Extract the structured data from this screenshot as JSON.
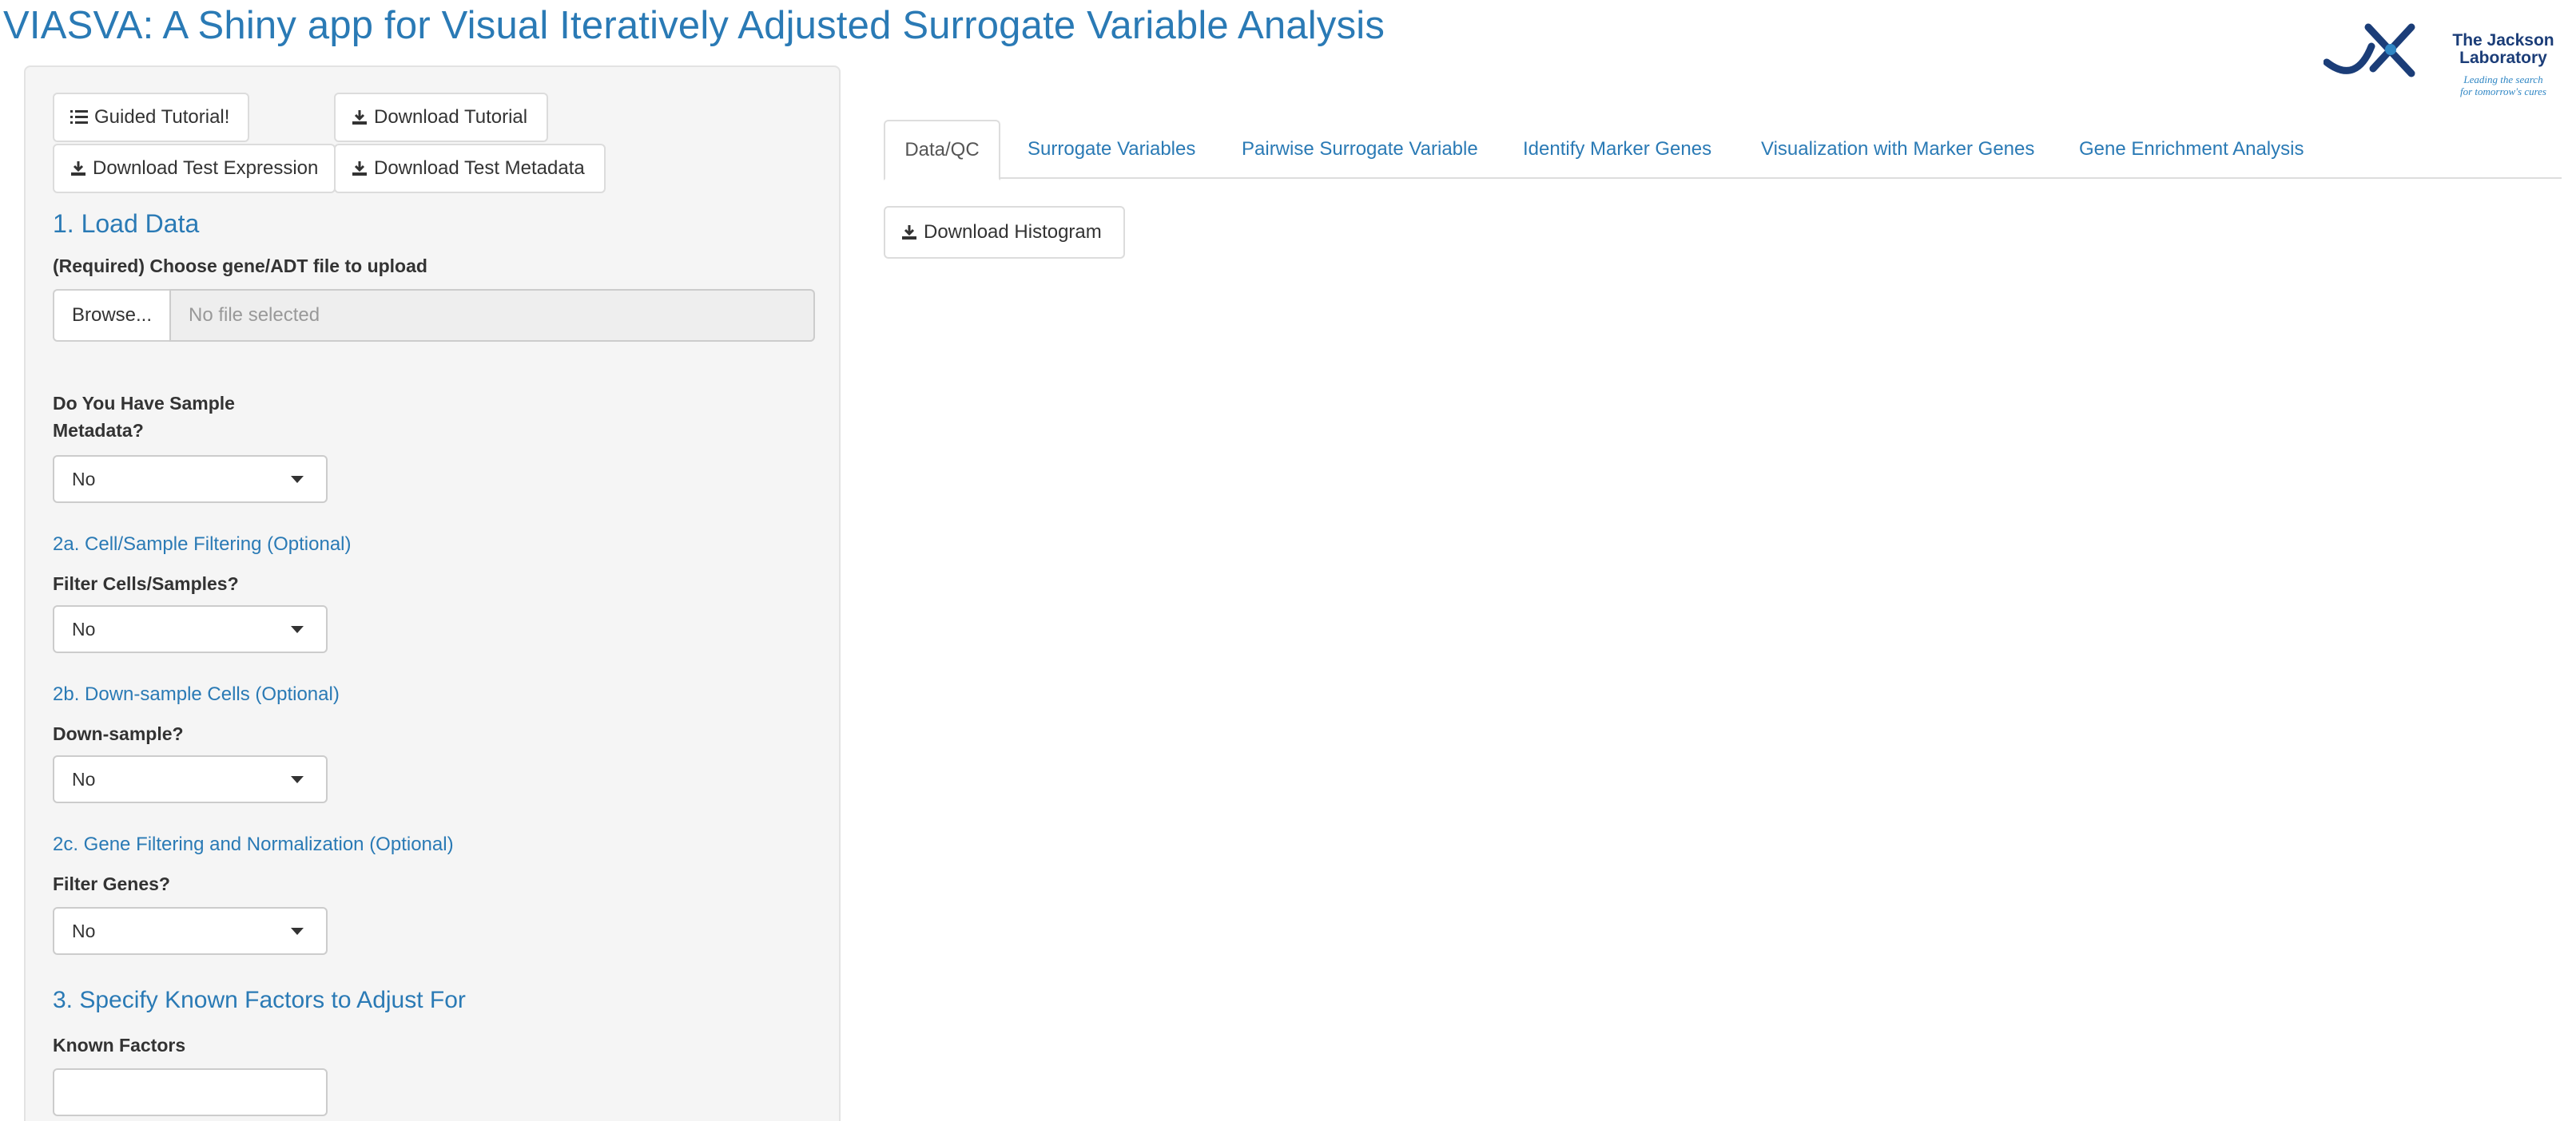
{
  "app": {
    "title": "VIASVA: A Shiny app for Visual Iteratively Adjusted Surrogate Variable Analysis"
  },
  "logo": {
    "name_line1": "The Jackson",
    "name_line2": "Laboratory",
    "tagline_line1": "Leading the search",
    "tagline_line2": "for tomorrow's cures",
    "mark_color": "#1b3d78",
    "accent_color": "#2f86c4"
  },
  "sidebar": {
    "buttons": {
      "guided_tutorial": "Guided Tutorial!",
      "download_tutorial": "Download Tutorial",
      "download_test_expression": "Download Test Expression",
      "download_test_metadata": "Download Test Metadata"
    },
    "load_data": {
      "heading": "1. Load Data",
      "label": "(Required) Choose gene/ADT file to upload",
      "browse_label": "Browse...",
      "file_placeholder": "No file selected"
    },
    "metadata": {
      "label_line1": "Do You Have Sample",
      "label_line2": "Metadata?",
      "value": "No"
    },
    "cell_filtering": {
      "heading": "2a. Cell/Sample Filtering (Optional)",
      "label": "Filter Cells/Samples?",
      "value": "No"
    },
    "downsample": {
      "heading": "2b. Down-sample Cells (Optional)",
      "label": "Down-sample?",
      "value": "No"
    },
    "gene_filtering": {
      "heading": "2c. Gene Filtering and Normalization (Optional)",
      "label": "Filter Genes?",
      "value": "No"
    },
    "known_factors": {
      "heading": "3. Specify Known Factors to Adjust For",
      "label": "Known Factors",
      "value": ""
    }
  },
  "main": {
    "tabs": [
      {
        "label": "Data/QC",
        "active": true
      },
      {
        "label": "Surrogate Variables",
        "active": false
      },
      {
        "label": "Pairwise Surrogate Variable",
        "active": false
      },
      {
        "label": "Identify Marker Genes",
        "active": false
      },
      {
        "label": "Visualization with Marker Genes",
        "active": false
      },
      {
        "label": "Gene Enrichment Analysis",
        "active": false
      }
    ],
    "download_histogram_label": "Download Histogram"
  },
  "colors": {
    "accent": "#2a7ab5",
    "sidebar_bg": "#f5f5f5"
  }
}
